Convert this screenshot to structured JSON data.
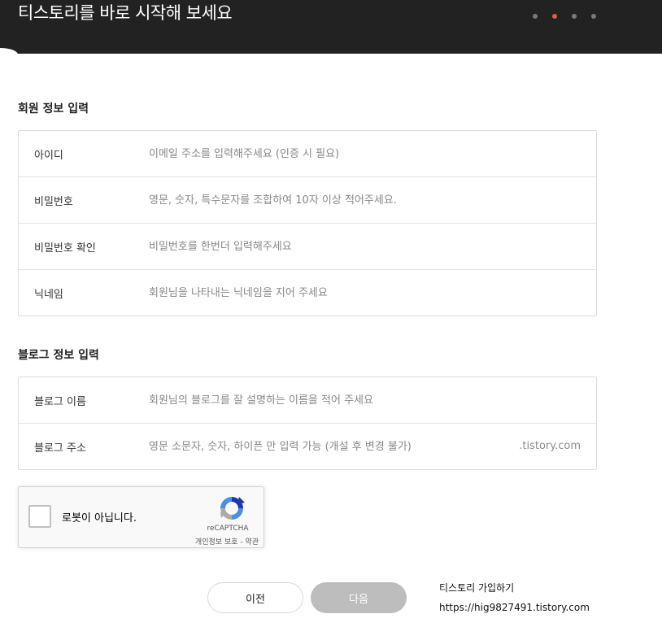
{
  "header": {
    "title": "티스토리를 바로 시작해 보세요",
    "step_dots": [
      {
        "active": false
      },
      {
        "active": true
      },
      {
        "active": false
      },
      {
        "active": false
      }
    ],
    "active_dot_color": "#ea5a3d"
  },
  "member_section": {
    "title": "회원 정보 입력",
    "fields": [
      {
        "label": "아이디",
        "placeholder": "이메일 주소를 입력해주세요 (인증 시 필요)"
      },
      {
        "label": "비밀번호",
        "placeholder": "영문, 숫자, 특수문자를 조합하여 10자 이상 적어주세요."
      },
      {
        "label": "비밀번호 확인",
        "placeholder": "비밀번호를 한번더 입력해주세요"
      },
      {
        "label": "닉네임",
        "placeholder": "회원님을 나타내는 닉네임을 지어 주세요"
      }
    ]
  },
  "blog_section": {
    "title": "블로그 정보 입력",
    "fields": [
      {
        "label": "블로그 이름",
        "placeholder": "회원님의 블로그를 잘 설명하는 이름을 적어 주세요"
      },
      {
        "label": "블로그 주소",
        "placeholder": "영문 소문자, 숫자, 하이픈 만 입력 가능 (개설 후 변경 불가)",
        "suffix": ".tistory.com"
      }
    ]
  },
  "recaptcha": {
    "label": "로봇이 아닙니다.",
    "brand": "reCAPTCHA",
    "links": "개인정보 보호 - 약관",
    "checked": false
  },
  "buttons": {
    "prev": "이전",
    "next": "다음",
    "next_disabled": true
  },
  "signup_info": {
    "title": "티스토리 가입하기",
    "url": "https://hig9827491.tistory.com"
  },
  "colors": {
    "header_bg": "#222222",
    "next_button_bg": "#bdbdbd",
    "border": "#dddddd"
  }
}
